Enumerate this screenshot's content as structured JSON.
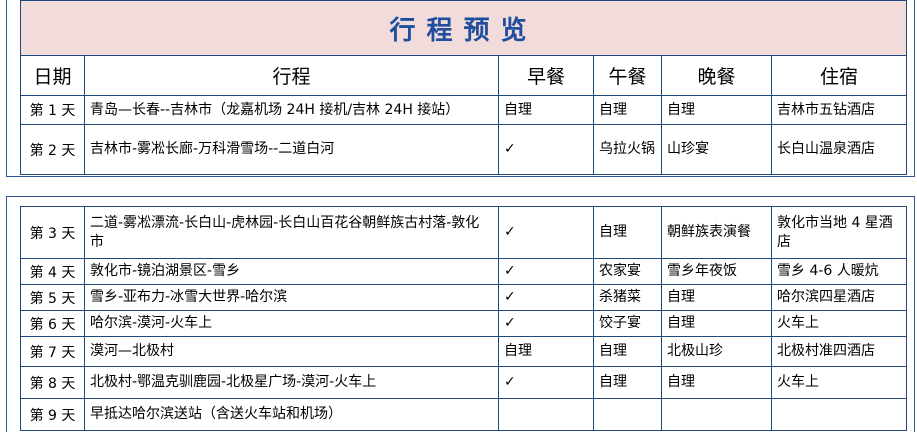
{
  "title": "行程预览",
  "headers": [
    "日期",
    "行程",
    "早餐",
    "午餐",
    "晚餐",
    "住宿"
  ],
  "rows_part1": [
    {
      "day": "第 1 天",
      "route": "青岛—长春--吉林市（龙嘉机场 24H 接机/吉林 24H 接站）",
      "breakfast": "自理",
      "lunch": "自理",
      "dinner": "自理",
      "hotel": "吉林市五钻酒店"
    },
    {
      "day": "第 2 天",
      "route": "吉林市-雾凇长廊-万科滑雪场--二道白河",
      "breakfast": "✓",
      "lunch": "乌拉火锅",
      "dinner": "山珍宴",
      "hotel": "长白山温泉酒店"
    }
  ],
  "rows_part2": [
    {
      "day": "第 3 天",
      "route": "二道-雾凇漂流-长白山-虎林园-长白山百花谷朝鲜族古村落-敦化市",
      "breakfast": "✓",
      "lunch": "自理",
      "dinner": "朝鲜族表演餐",
      "hotel": "敦化市当地 4 星酒店"
    },
    {
      "day": "第 4 天",
      "route": "敦化市-镜泊湖景区-雪乡",
      "breakfast": "✓",
      "lunch": "农家宴",
      "dinner": "雪乡年夜饭",
      "hotel": "雪乡 4-6 人暖炕"
    },
    {
      "day": "第 5 天",
      "route": "雪乡-亚布力-冰雪大世界-哈尔滨",
      "breakfast": "✓",
      "lunch": "杀猪菜",
      "dinner": "自理",
      "hotel": "哈尔滨四星酒店"
    },
    {
      "day": "第 6 天",
      "route": "哈尔滨-漠河-火车上",
      "breakfast": "✓",
      "lunch": "饺子宴",
      "dinner": "自理",
      "hotel": "火车上"
    },
    {
      "day": "第 7 天",
      "route": "漠河—北极村",
      "breakfast": "自理",
      "lunch": "自理",
      "dinner": "北极山珍",
      "hotel": "北极村准四酒店"
    },
    {
      "day": "第 8 天",
      "route": "北极村-鄂温克驯鹿园-北极星广场-漠河-火车上",
      "breakfast": "✓",
      "lunch": "自理",
      "dinner": "自理",
      "hotel": "火车上"
    },
    {
      "day": "第 9 天",
      "route": "早抵达哈尔滨送站（含送火车站和机场）",
      "breakfast": "",
      "lunch": "",
      "dinner": "",
      "hotel": ""
    }
  ]
}
